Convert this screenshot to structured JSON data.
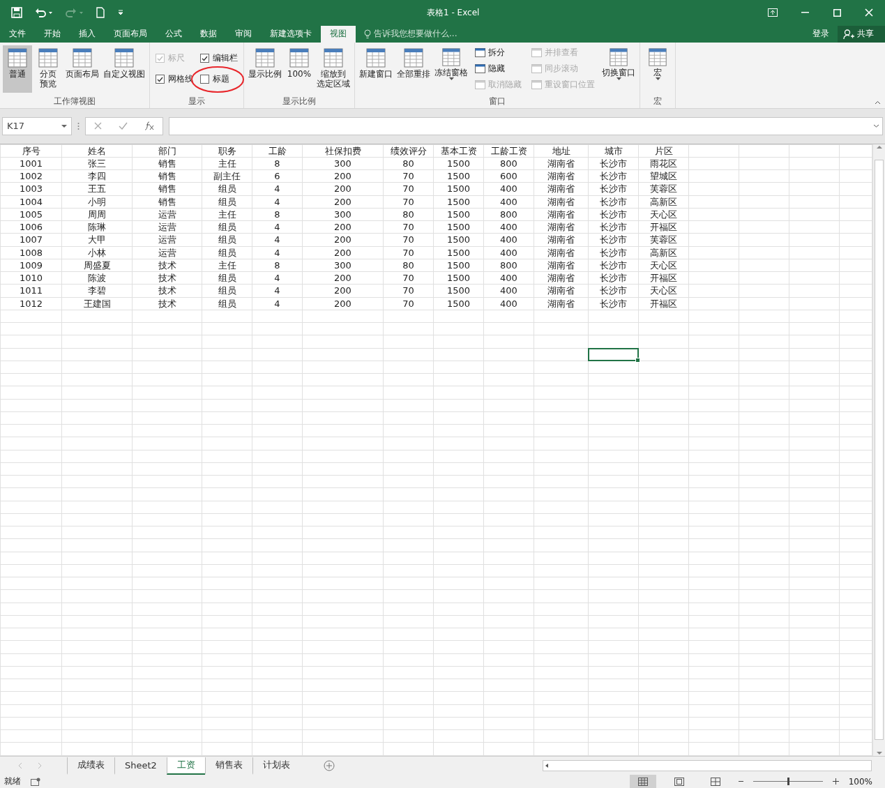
{
  "window": {
    "title": "表格1 - Excel"
  },
  "tabs": [
    {
      "label": "文件",
      "selected": false
    },
    {
      "label": "开始",
      "selected": false
    },
    {
      "label": "插入",
      "selected": false
    },
    {
      "label": "页面布局",
      "selected": false
    },
    {
      "label": "公式",
      "selected": false
    },
    {
      "label": "数据",
      "selected": false
    },
    {
      "label": "审阅",
      "selected": false
    },
    {
      "label": "新建选项卡",
      "selected": false
    },
    {
      "label": "视图",
      "selected": true
    }
  ],
  "tell_me": {
    "placeholder": "告诉我您想要做什么..."
  },
  "account": {
    "sign_in": "登录",
    "share": "共享"
  },
  "ribbon": [
    {
      "label": "工作簿视图",
      "items": [
        {
          "kind": "large",
          "label": "普通",
          "selected": true
        },
        {
          "kind": "large",
          "label": "分页预览",
          "selected": false,
          "wrap": true
        },
        {
          "kind": "large",
          "label": "页面布局",
          "selected": false
        },
        {
          "kind": "large",
          "label": "自定义视图",
          "selected": false
        }
      ]
    },
    {
      "label": "显示",
      "items": [
        {
          "kind": "check",
          "label": "标尺",
          "checked": true,
          "disabled": true,
          "circled": false
        },
        {
          "kind": "check",
          "label": "网格线",
          "checked": true,
          "disabled": false,
          "circled": false
        },
        {
          "kind": "check",
          "label": "编辑栏",
          "checked": true,
          "disabled": false,
          "circled": false
        },
        {
          "kind": "check",
          "label": "标题",
          "checked": false,
          "disabled": false,
          "circled": true
        }
      ]
    },
    {
      "label": "显示比例",
      "items": [
        {
          "kind": "large",
          "label": "显示比例",
          "selected": false
        },
        {
          "kind": "large",
          "label": "100%",
          "selected": false
        },
        {
          "kind": "large",
          "label": "缩放到选定区域",
          "selected": false,
          "wrap": true
        }
      ]
    },
    {
      "label": "窗口",
      "items": [
        {
          "kind": "large",
          "label": "新建窗口",
          "selected": false
        },
        {
          "kind": "large",
          "label": "全部重排",
          "selected": false
        },
        {
          "kind": "large",
          "label": "冻结窗格",
          "selected": false,
          "dropdown": true
        },
        {
          "kind": "small",
          "label": "拆分",
          "disabled": false
        },
        {
          "kind": "small",
          "label": "隐藏",
          "disabled": false
        },
        {
          "kind": "small",
          "label": "取消隐藏",
          "disabled": true
        },
        {
          "kind": "small",
          "label": "并排查看",
          "disabled": true
        },
        {
          "kind": "small",
          "label": "同步滚动",
          "disabled": true
        },
        {
          "kind": "small",
          "label": "重设窗口位置",
          "disabled": true
        },
        {
          "kind": "large",
          "label": "切换窗口",
          "selected": false,
          "dropdown": true
        }
      ]
    },
    {
      "label": "宏",
      "items": [
        {
          "kind": "large",
          "label": "宏",
          "selected": false,
          "dropdown": true
        }
      ]
    }
  ],
  "formula_bar": {
    "name_box": "K17"
  },
  "sheet": {
    "active_cell_visible": true,
    "rows": [
      [
        "序号",
        "姓名",
        "部门",
        "职务",
        "工龄",
        "社保扣费",
        "绩效评分",
        "基本工资",
        "工龄工资",
        "地址",
        "城市",
        "片区"
      ],
      [
        "1001",
        "张三",
        "销售",
        "主任",
        "8",
        "300",
        "80",
        "1500",
        "800",
        "湖南省",
        "长沙市",
        "雨花区"
      ],
      [
        "1002",
        "李四",
        "销售",
        "副主任",
        "6",
        "200",
        "70",
        "1500",
        "600",
        "湖南省",
        "长沙市",
        "望城区"
      ],
      [
        "1003",
        "王五",
        "销售",
        "组员",
        "4",
        "200",
        "70",
        "1500",
        "400",
        "湖南省",
        "长沙市",
        "芙蓉区"
      ],
      [
        "1004",
        "小明",
        "销售",
        "组员",
        "4",
        "200",
        "70",
        "1500",
        "400",
        "湖南省",
        "长沙市",
        "高新区"
      ],
      [
        "1005",
        "周周",
        "运营",
        "主任",
        "8",
        "300",
        "80",
        "1500",
        "800",
        "湖南省",
        "长沙市",
        "天心区"
      ],
      [
        "1006",
        "陈琳",
        "运营",
        "组员",
        "4",
        "200",
        "70",
        "1500",
        "400",
        "湖南省",
        "长沙市",
        "开福区"
      ],
      [
        "1007",
        "大甲",
        "运营",
        "组员",
        "4",
        "200",
        "70",
        "1500",
        "400",
        "湖南省",
        "长沙市",
        "芙蓉区"
      ],
      [
        "1008",
        "小林",
        "运营",
        "组员",
        "4",
        "200",
        "70",
        "1500",
        "400",
        "湖南省",
        "长沙市",
        "高新区"
      ],
      [
        "1009",
        "周盛夏",
        "技术",
        "主任",
        "8",
        "300",
        "80",
        "1500",
        "800",
        "湖南省",
        "长沙市",
        "天心区"
      ],
      [
        "1010",
        "陈波",
        "技术",
        "组员",
        "4",
        "200",
        "70",
        "1500",
        "400",
        "湖南省",
        "长沙市",
        "开福区"
      ],
      [
        "1011",
        "李碧",
        "技术",
        "组员",
        "4",
        "200",
        "70",
        "1500",
        "400",
        "湖南省",
        "长沙市",
        "天心区"
      ],
      [
        "1012",
        "王建国",
        "技术",
        "组员",
        "4",
        "200",
        "70",
        "1500",
        "400",
        "湖南省",
        "长沙市",
        "开福区"
      ]
    ]
  },
  "sheet_tabs": [
    {
      "label": "成绩表",
      "selected": false
    },
    {
      "label": "Sheet2",
      "selected": false
    },
    {
      "label": "工资",
      "selected": true
    },
    {
      "label": "销售表",
      "selected": false
    },
    {
      "label": "计划表",
      "selected": false
    }
  ],
  "status_bar": {
    "status": "就绪",
    "zoom": "100%",
    "zoom_level": {
      "level": 0.5
    },
    "views": [
      {
        "selected": true
      },
      {
        "selected": false
      },
      {
        "selected": false
      }
    ]
  }
}
